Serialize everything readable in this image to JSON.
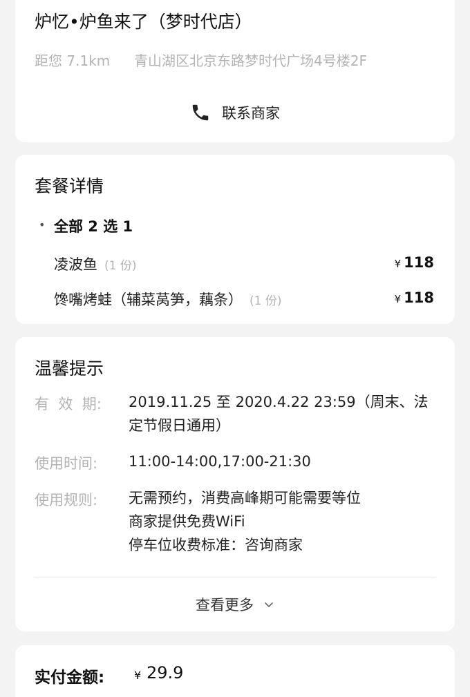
{
  "store": {
    "name": "炉忆•炉鱼来了（梦时代店）",
    "distance": "距您 7.1km",
    "address": "青山湖区北京东路梦时代广场4号楼2F",
    "contact_label": "联系商家",
    "contact_icon": "phone-icon"
  },
  "package": {
    "title": "套餐详情",
    "bullet": "•",
    "group_label": "全部 2 选 1",
    "items": [
      {
        "name": "凌波鱼",
        "qty": "(1 份)",
        "currency": "¥",
        "price": "118"
      },
      {
        "name": "馋嘴烤蛙（辅菜莴笋，藕条）",
        "qty": "(1 份)",
        "currency": "¥",
        "price": "118"
      }
    ]
  },
  "tips": {
    "title": "温馨提示",
    "rows": [
      {
        "label": "有  效  期:",
        "value": "2019.11.25 至 2020.4.22 23:59（周末、法定节假日通用）"
      },
      {
        "label": "使用时间:",
        "value": "11:00-14:00,17:00-21:30"
      },
      {
        "label": "使用规则:",
        "lines": [
          "无需预约，消费高峰期可能需要等位",
          "商家提供免费WiFi",
          "停车位收费标准：咨询商家"
        ]
      }
    ],
    "more_label": "查看更多",
    "more_icon": "chevron-down-icon"
  },
  "payment": {
    "label": "实付金额:",
    "currency": "¥",
    "amount": "29.9"
  },
  "colors": {
    "background": "#f3f3f3",
    "card": "#ffffff",
    "muted_text": "#b3b3b3",
    "primary_text": "#222222"
  }
}
